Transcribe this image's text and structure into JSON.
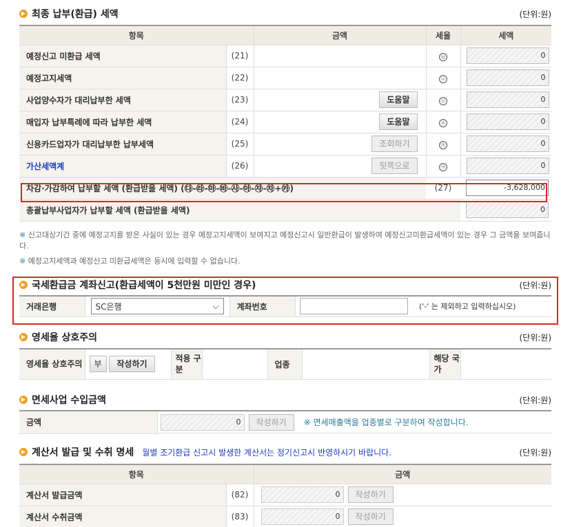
{
  "section1": {
    "title": "최종 납부(환급) 세액",
    "unit": "(단위:원)",
    "headers": [
      "항목",
      "금액",
      "세율",
      "세액"
    ],
    "rows": [
      {
        "label": "예정신고 미환급 세액",
        "num": "(21)",
        "rate": "㉥",
        "tax": "0"
      },
      {
        "label": "예정고지세액",
        "num": "(22)",
        "rate": "㉦",
        "tax": "0"
      },
      {
        "label": "사업양수자가 대리납부한 세액",
        "num": "(23)",
        "button": "도움말",
        "rate": "㉧",
        "tax": "0"
      },
      {
        "label": "매입자 납부특례에 따라 납부한 세액",
        "num": "(24)",
        "button": "도움말",
        "rate": "㉨",
        "tax": "0"
      },
      {
        "label": "신용카드업자가 대리납부한 납부세액",
        "num": "(25)",
        "button": "조회하기",
        "rate": "㉩",
        "tax": "0"
      },
      {
        "label": "가산세액계",
        "num": "(26)",
        "button": "뒷쪽으로",
        "rate": "㉪",
        "tax": "0"
      }
    ],
    "total_row": {
      "label": "차감·가감하여 납부할 세액 (환급받을 세액) (㉰-㉱-㉲-㉳-㉴-㉵-㉶-㉷+㉸)",
      "num": "(27)",
      "tax": "-3,628,000"
    },
    "last_row": {
      "label": "총괄납부사업자가 납부할 세액 (환급받을 세액)",
      "tax": "0"
    }
  },
  "notes": {
    "note1_mark": "※",
    "note1": "신고대상기간 중에 예정고지를 받은 사실이 있는 경우 예정고지세액이 보여지고 예정신고시 일반환급이 발생하여 예정신고미환급세액이 있는 경우 그 금액을 보여줍니다.",
    "note2_mark": "※",
    "note2": "예정고지세액과 예정신고 미환급세액은 동시에 입력할 수 없습니다."
  },
  "section2": {
    "title": "국세환급금 계좌신고(환급세액이 5천만원 미만인 경우)",
    "unit": "(단위:원)",
    "bank_label": "거래은행",
    "bank_value": "SC은행",
    "account_label": "계좌번호",
    "hint": "('-' 는 제외하고 입력하십시오)"
  },
  "section3": {
    "title": "영세율 상호주의",
    "unit": "(단위:원)",
    "label": "영세율 상호주의",
    "value": "부",
    "button": "작성하기",
    "label2": "적용 구분",
    "label3": "업종",
    "label4": "해당 국가"
  },
  "section4": {
    "title": "면세사업 수입금액",
    "unit": "(단위:원)",
    "label": "금액",
    "value": "0",
    "button": "작성하기",
    "note": "※ 면세매출액을 업종별로 구분하여 작성합니다."
  },
  "section5": {
    "title": "계산서 발급 및 수취 명세",
    "note": "월별 조기환급 신고시 발생한 계산서는 정기신고시 반영하시기 바랍니다.",
    "unit": "(단위:원)",
    "headers": [
      "항목",
      "금액"
    ],
    "rows": [
      {
        "label": "계산서 발급금액",
        "num": "(82)",
        "value": "0",
        "button": "작성하기"
      },
      {
        "label": "계산서 수취금액",
        "num": "(83)",
        "value": "0",
        "button": "작성하기"
      }
    ]
  },
  "colors": {
    "accent": "#f0a020",
    "highlight_border": "#d9262c",
    "link_blue": "#1a3dbd"
  }
}
